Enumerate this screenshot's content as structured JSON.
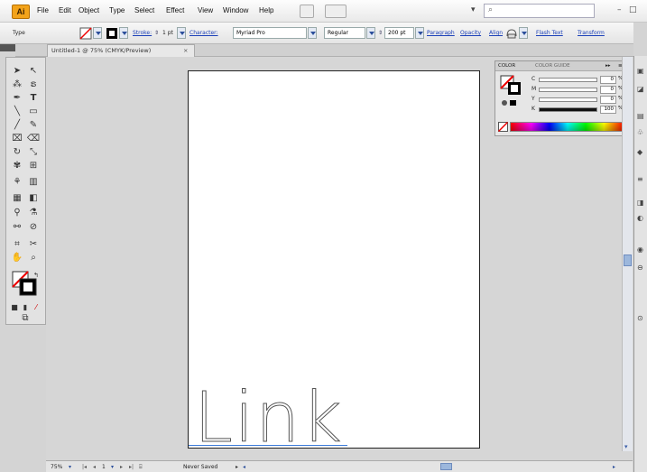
{
  "app": {
    "logo": "Ai"
  },
  "menu": [
    "File",
    "Edit",
    "Object",
    "Type",
    "Select",
    "Effect",
    "View",
    "Window",
    "Help"
  ],
  "control_bar": {
    "selection_label": "Type",
    "stroke_label": "Stroke:",
    "stroke_value": "1 pt",
    "character_label": "Character:",
    "font_family": "Myriad Pro",
    "font_style": "Regular",
    "font_size": "200 pt",
    "paragraph_label": "Paragraph",
    "opacity_label": "Opacity",
    "align_label": "Align",
    "flash_text_label": "Flash Text",
    "transform_label": "Transform"
  },
  "document": {
    "tab_title": "Untitled-1 @ 75% (CMYK/Preview)",
    "close_glyph": "×",
    "artboard_text": "Link"
  },
  "color_panel": {
    "tab_color": "COLOR",
    "tab_guide": "COLOR GUIDE",
    "sliders": [
      {
        "label": "C",
        "value": "0",
        "unit": "%",
        "fill": 0
      },
      {
        "label": "M",
        "value": "0",
        "unit": "%",
        "fill": 0
      },
      {
        "label": "Y",
        "value": "0",
        "unit": "%",
        "fill": 0
      },
      {
        "label": "K",
        "value": "100",
        "unit": "%",
        "fill": 1
      }
    ]
  },
  "status_bar": {
    "zoom": "75%",
    "page": "1",
    "save_state": "Never Saved"
  },
  "colors": {
    "ai_orange": "#f3a31a",
    "link_blue": "#1a3fb8",
    "selection_blue": "#3d7bd8"
  }
}
